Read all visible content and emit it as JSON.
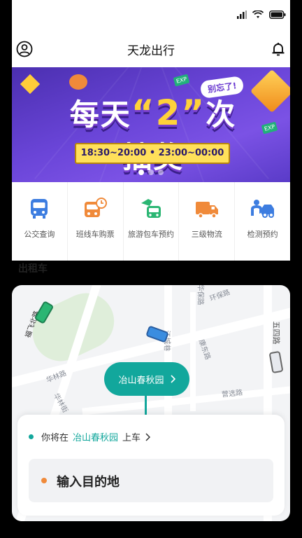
{
  "app": {
    "title": "天龙出行"
  },
  "banner": {
    "headline_pre": "每天",
    "headline_num": "“2”",
    "headline_post": "次抽奖",
    "tag": "别忘了!",
    "time": "18:30~20:00 • 23:00~00:00",
    "chip": "EXP",
    "page_count": 3,
    "active_page": 1
  },
  "quick_menu": [
    {
      "label": "公交查询",
      "icon": "bus-icon",
      "color": "#3d7de0"
    },
    {
      "label": "班线车购票",
      "icon": "scheduled-bus-icon",
      "color": "#f08a3a"
    },
    {
      "label": "旅游包车预约",
      "icon": "tour-bus-icon",
      "color": "#2bb673"
    },
    {
      "label": "三级物流",
      "icon": "truck-icon",
      "color": "#f08a3a"
    },
    {
      "label": "检测预约",
      "icon": "car-inspection-icon",
      "color": "#3d7de0"
    }
  ],
  "section": {
    "taxi": "出租车"
  },
  "map": {
    "pin_label": "冶山春秋园",
    "roads": [
      "华保路",
      "环保路",
      "五四路",
      "康东路",
      "华林路",
      "华林街",
      "营选路",
      "福飞北路",
      "江城巷"
    ]
  },
  "booking": {
    "pickup_prefix": "你将在",
    "pickup_place": "冶山春秋园",
    "pickup_suffix": "上车",
    "destination_placeholder": "输入目的地"
  },
  "colors": {
    "accent": "#12a79c",
    "origin": "#12a79c",
    "destination": "#f08a3a"
  }
}
